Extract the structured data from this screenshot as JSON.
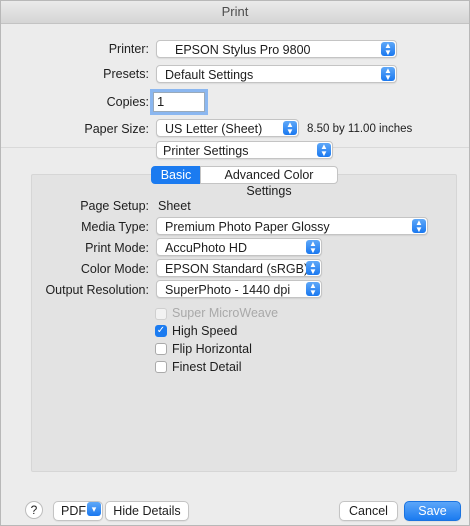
{
  "window": {
    "title": "Print"
  },
  "printer": {
    "label": "Printer:",
    "value": "EPSON Stylus Pro 9800"
  },
  "presets": {
    "label": "Presets:",
    "value": "Default Settings"
  },
  "copies": {
    "label": "Copies:",
    "value": "1"
  },
  "paper_size": {
    "label": "Paper Size:",
    "value": "US Letter (Sheet)",
    "dimensions": "8.50 by 11.00 inches"
  },
  "section": {
    "value": "Printer Settings"
  },
  "tabs": [
    {
      "label": "Basic",
      "active": true
    },
    {
      "label": "Advanced Color Settings",
      "active": false
    }
  ],
  "basic": {
    "page_setup": {
      "label": "Page Setup:",
      "value": "Sheet"
    },
    "media_type": {
      "label": "Media Type:",
      "value": "Premium Photo Paper Glossy"
    },
    "print_mode": {
      "label": "Print Mode:",
      "value": "AccuPhoto HD"
    },
    "color_mode": {
      "label": "Color Mode:",
      "value": "EPSON Standard (sRGB)"
    },
    "output_resolution": {
      "label": "Output Resolution:",
      "value": "SuperPhoto - 1440 dpi"
    },
    "options": [
      {
        "label": "Super MicroWeave",
        "checked": false,
        "enabled": false
      },
      {
        "label": "High Speed",
        "checked": true,
        "enabled": true
      },
      {
        "label": "Flip Horizontal",
        "checked": false,
        "enabled": true
      },
      {
        "label": "Finest Detail",
        "checked": false,
        "enabled": true
      }
    ]
  },
  "footer": {
    "help": "?",
    "pdf": "PDF",
    "hide_details": "Hide Details",
    "cancel": "Cancel",
    "save": "Save"
  },
  "colors": {
    "accent": "#1b7bf0",
    "panel": "#e3e3e3",
    "window": "#ececec"
  }
}
